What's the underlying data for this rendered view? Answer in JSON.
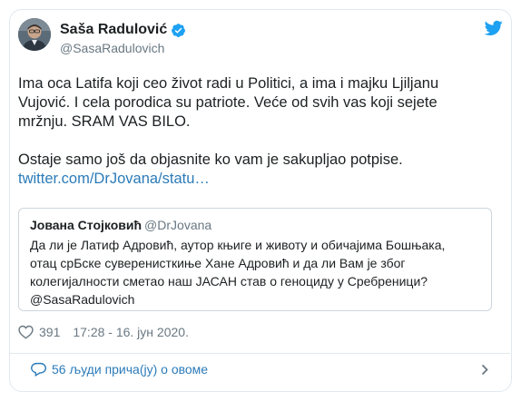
{
  "tweet": {
    "author_name": "Saša Radulović",
    "author_handle": "@SasaRadulovich",
    "paragraph_1": "Ima oca Latifa koji ceo život radi u Politici, a ima i majku Ljiljanu Vujović. I cela porodica su patriote. Veće od svih vas koji sejete mržnju. SRAM VAS BILO.",
    "paragraph_2": "Ostaje samo još da objasnite ko vam je sakupljao potpise.",
    "link_text": "twitter.com/DrJovana/statu…",
    "likes": "391",
    "timestamp": "17:28 - 16. јун 2020.",
    "people_talking": "56 људи прича(ју) о овоме"
  },
  "quoted": {
    "author_name": "Јована Стојковић",
    "author_handle": "@DrJovana",
    "text": "Да ли је Латиф Адровић, аутор књиге и животу и обичајима Бошњака,\nотац срБске суверенисткиње Хане Адровић и да ли Вам је због\nколегијалности сметао наш ЈАСАН став о геноциду у Сребреници?\n@SasaRadulovich"
  },
  "colors": {
    "twitter_blue": "#1da1f2",
    "link": "#2b7bb9",
    "secondary_text": "#697882",
    "border": "#e1e8ed"
  },
  "icons": {
    "verified": "verified-badge-icon",
    "logo": "twitter-bird-icon",
    "like": "heart-icon",
    "conversation": "speech-bubble-icon",
    "more": "chevron-right-icon"
  }
}
